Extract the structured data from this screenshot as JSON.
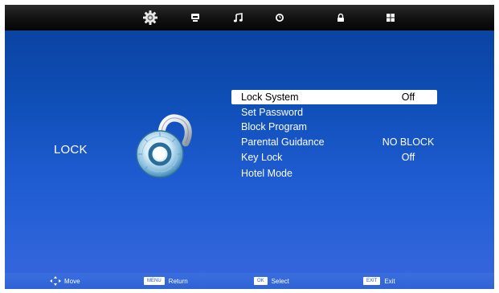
{
  "tabs": [
    {
      "id": "picture",
      "icon": "gear-icon",
      "active": true
    },
    {
      "id": "picture-settings",
      "icon": "monitor-icon",
      "active": false
    },
    {
      "id": "sound",
      "icon": "music-note-icon",
      "active": false
    },
    {
      "id": "time",
      "icon": "clock-icon",
      "active": false
    },
    {
      "id": "lock",
      "icon": "padlock-icon",
      "active": false
    },
    {
      "id": "setup",
      "icon": "grid-icon",
      "active": false
    }
  ],
  "page": {
    "title": "LOCK"
  },
  "menu": {
    "items": [
      {
        "label": "Lock System",
        "value": "Off"
      },
      {
        "label": "Set Password",
        "value": ""
      },
      {
        "label": "Block Program",
        "value": ""
      },
      {
        "label": "Parental Guidance",
        "value": "NO BLOCK"
      },
      {
        "label": "Key Lock",
        "value": "Off"
      },
      {
        "label": "Hotel Mode",
        "value": ""
      }
    ],
    "selected_index": 0
  },
  "footer": {
    "move": {
      "icon": "directional-pad-icon",
      "label": "Move"
    },
    "return": {
      "key": "MENU",
      "label": "Return"
    },
    "select": {
      "key": "OK",
      "label": "Select"
    },
    "exit": {
      "key": "EXIT",
      "label": "Exit"
    }
  },
  "colors": {
    "background_top": "#0a3f9a",
    "background_bottom": "#3966de",
    "selection": "#ffffff",
    "text": "#ffffff"
  }
}
